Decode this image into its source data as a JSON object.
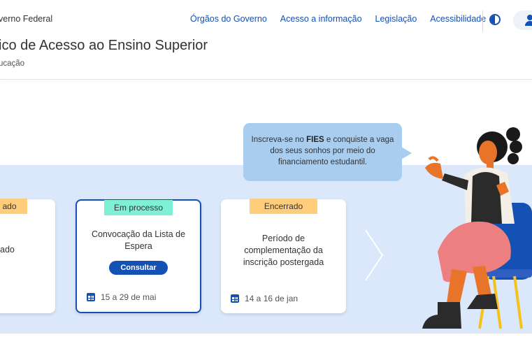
{
  "header": {
    "gov_name": "verno Federal",
    "nav": [
      "Órgãos do Governo",
      "Acesso a informação",
      "Legislação",
      "Acessibilidade"
    ],
    "contrast_icon": "contrast-icon",
    "user_icon": "user-icon"
  },
  "site": {
    "title": "ico de Acesso ao Ensino Superior",
    "subtitle": "ucação"
  },
  "promo": {
    "before": "Inscreva-se no ",
    "highlight": "FIES",
    "after": " e conquiste a vaga dos seus sonhos por meio do financiamento estudantil."
  },
  "cards": [
    {
      "badge": "ado",
      "text": "ado"
    },
    {
      "badge": "Em processo",
      "text": "Convocação da Lista de Espera",
      "button": "Consultar",
      "date": "15 a 29 de mai"
    },
    {
      "badge": "Encerrado",
      "text": "Período de complementação da inscrição postergada",
      "date": "14 a 16 de jan"
    }
  ],
  "colors": {
    "primary": "#1351b4",
    "band": "#dbe8fb",
    "badge_closed": "#ffcd7b",
    "badge_in_progress": "#7ef0d5",
    "bubble": "#a9cdee"
  },
  "icons": {
    "calendar": "calendar-icon",
    "next": "chevron-right-icon"
  }
}
